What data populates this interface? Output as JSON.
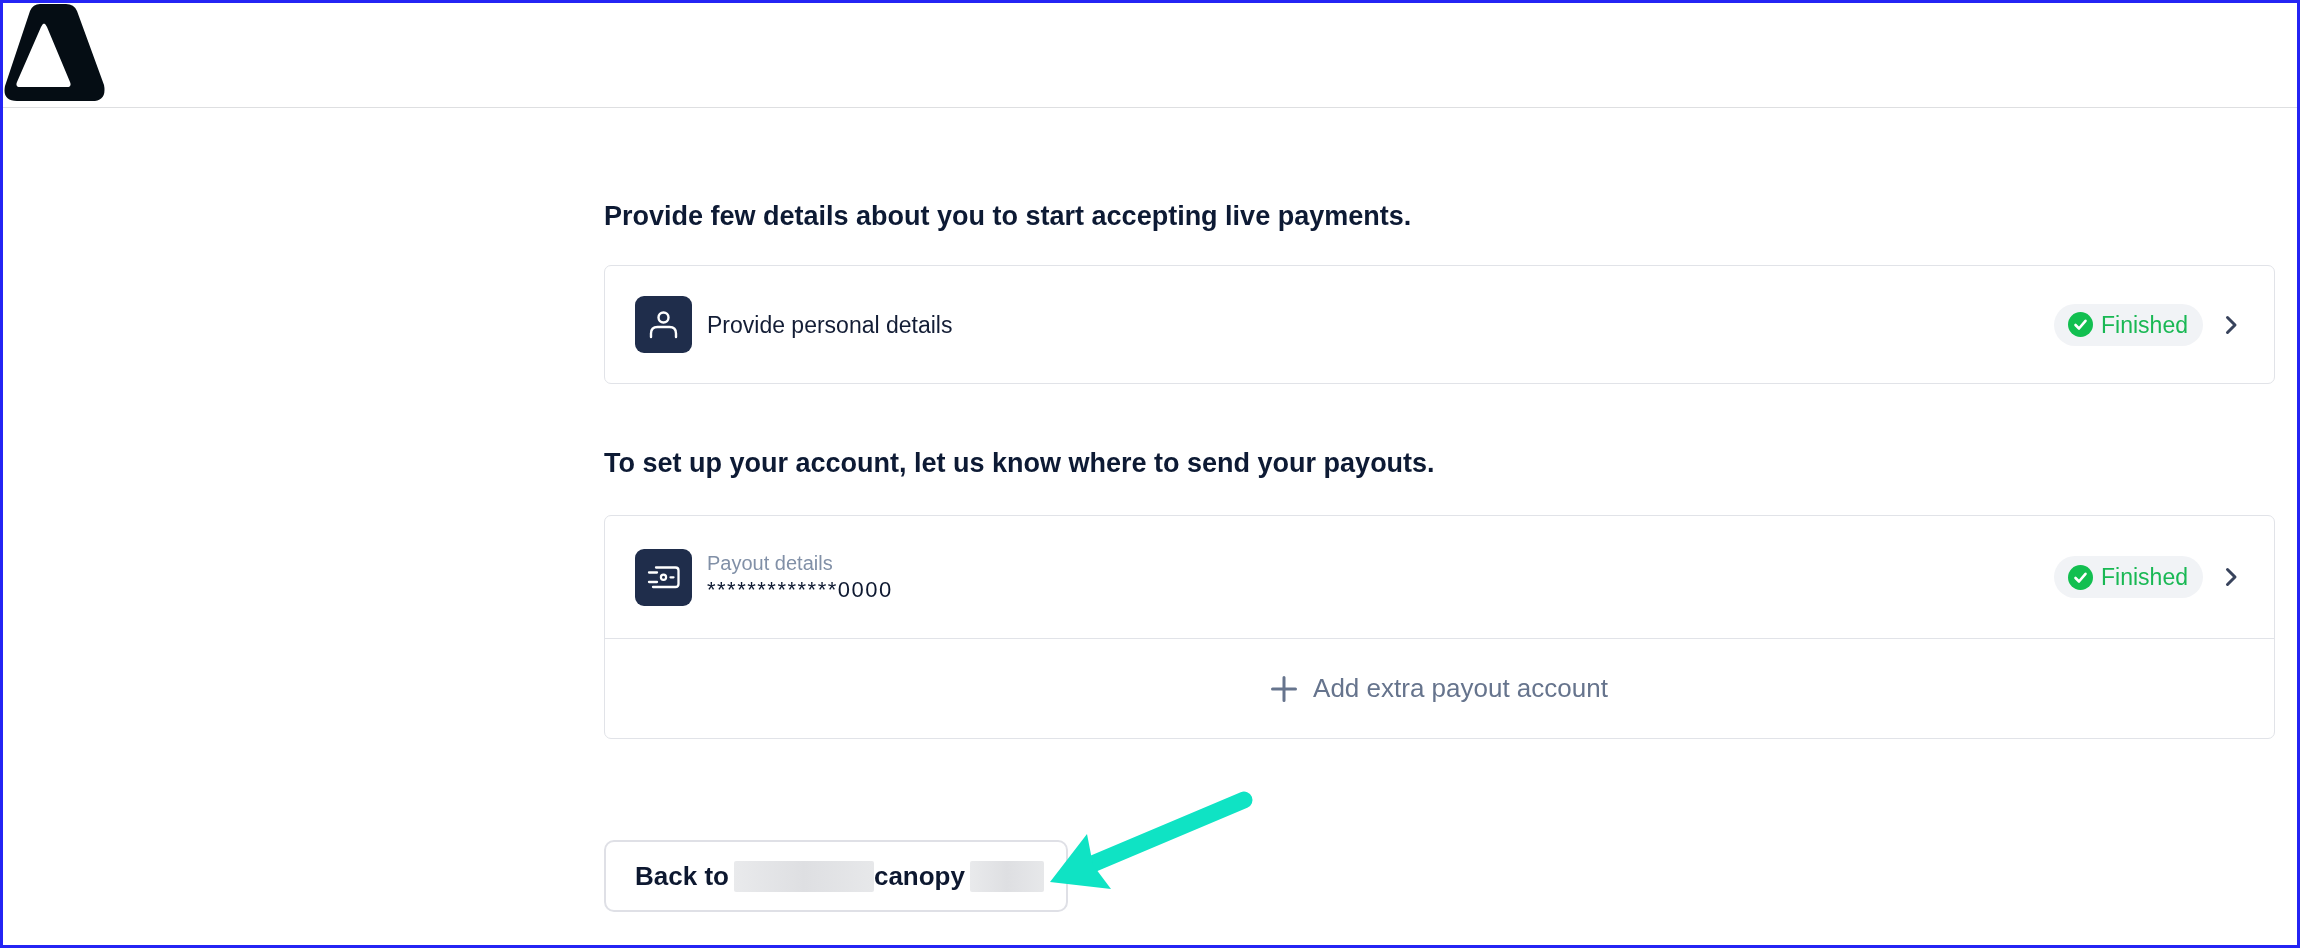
{
  "sections": [
    {
      "heading": "Provide few details about you to start accepting live payments.",
      "items": [
        {
          "kind": "personal",
          "title": "Provide personal details",
          "status": {
            "label": "Finished",
            "done": true
          }
        }
      ]
    },
    {
      "heading": "To set up your account, let us know where to send your payouts.",
      "items": [
        {
          "kind": "payout",
          "label": "Payout details",
          "value": "*************0000",
          "status": {
            "label": "Finished",
            "done": true
          }
        }
      ],
      "add_action": {
        "label": "Add extra payout account"
      }
    }
  ],
  "back_button": {
    "parts": [
      {
        "kind": "text",
        "text": "Back to"
      },
      {
        "kind": "redacted"
      },
      {
        "kind": "text",
        "text": "canopy"
      },
      {
        "kind": "redacted"
      }
    ]
  },
  "annotations": [
    {
      "kind": "arrow"
    }
  ]
}
